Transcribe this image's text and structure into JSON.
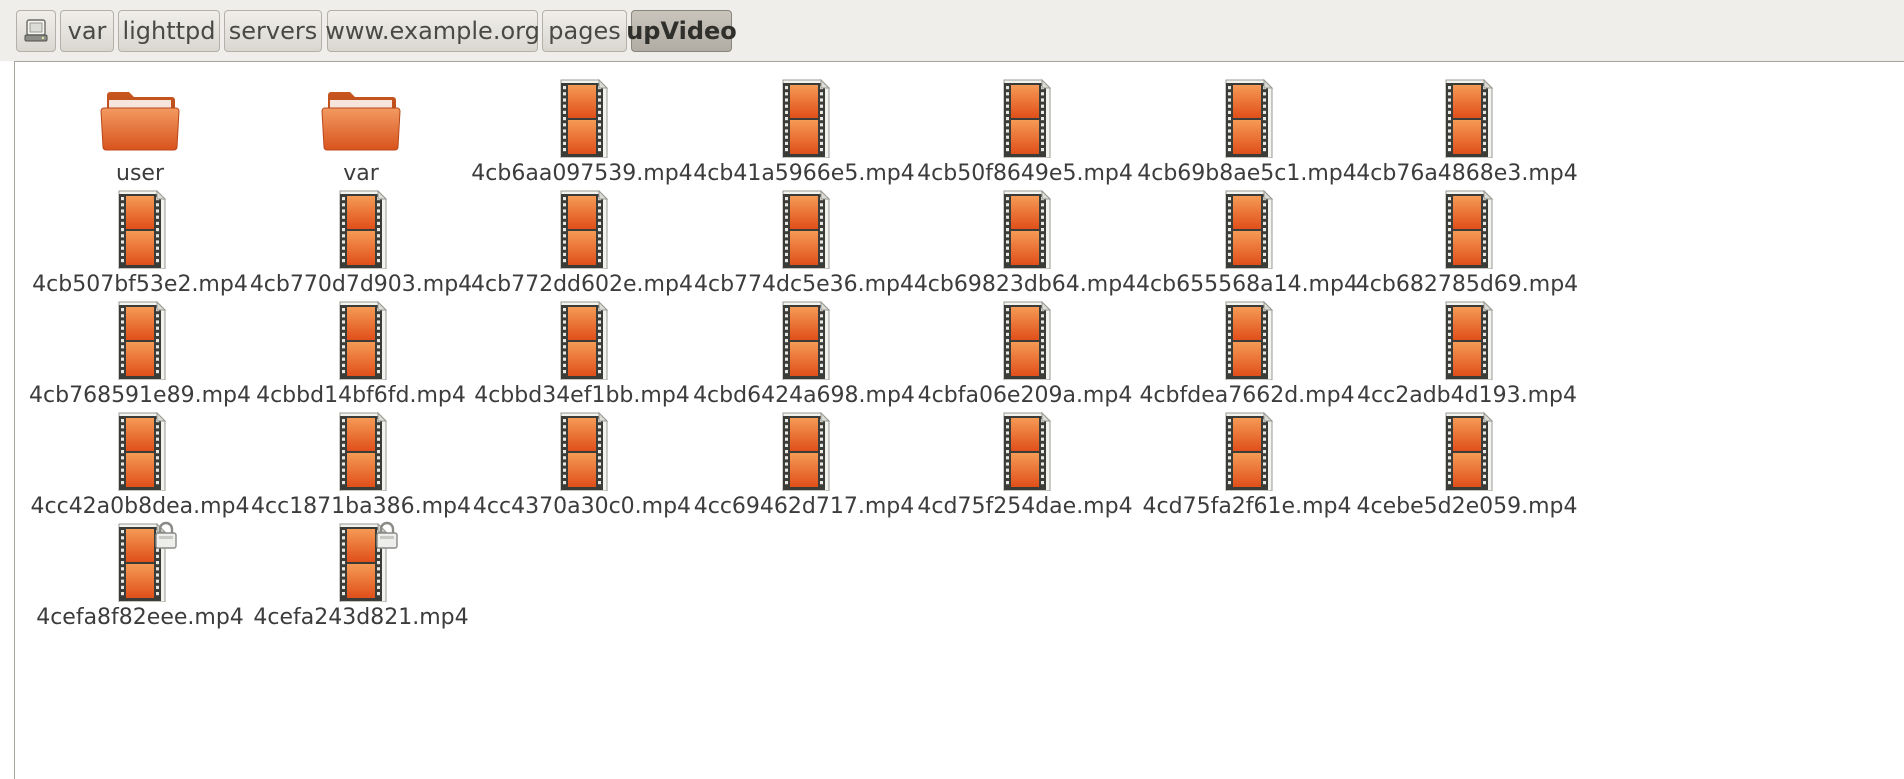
{
  "pathbar": {
    "home_icon": "drive-icon",
    "crumbs": [
      "var",
      "lighttpd",
      "servers",
      "www.example.org",
      "pages",
      "upVideo"
    ],
    "active_crumb": "upVideo"
  },
  "colors": {
    "folder_orange": "#e2622a",
    "video_orange": "#e8732c",
    "film_dark": "#3b3b38",
    "active_crumb_bg": "#bbb7ae"
  },
  "files": [
    {
      "name": "user",
      "type": "folder",
      "locked": false
    },
    {
      "name": "var",
      "type": "folder",
      "locked": false
    },
    {
      "name": "4cb6aa097539.mp4",
      "type": "video",
      "locked": false
    },
    {
      "name": "4cb41a5966e5.mp4",
      "type": "video",
      "locked": false
    },
    {
      "name": "4cb50f8649e5.mp4",
      "type": "video",
      "locked": false
    },
    {
      "name": "4cb69b8ae5c1.mp4",
      "type": "video",
      "locked": false
    },
    {
      "name": "4cb76a4868e3.mp4",
      "type": "video",
      "locked": false
    },
    {
      "name": "4cb507bf53e2.mp4",
      "type": "video",
      "locked": false
    },
    {
      "name": "4cb770d7d903.mp4",
      "type": "video",
      "locked": false
    },
    {
      "name": "4cb772dd602e.mp4",
      "type": "video",
      "locked": false
    },
    {
      "name": "4cb774dc5e36.mp4",
      "type": "video",
      "locked": false
    },
    {
      "name": "4cb69823db64.mp4",
      "type": "video",
      "locked": false
    },
    {
      "name": "4cb655568a14.mp4",
      "type": "video",
      "locked": false
    },
    {
      "name": "4cb682785d69.mp4",
      "type": "video",
      "locked": false
    },
    {
      "name": "4cb768591e89.mp4",
      "type": "video",
      "locked": false
    },
    {
      "name": "4cbbd14bf6fd.mp4",
      "type": "video",
      "locked": false
    },
    {
      "name": "4cbbd34ef1bb.mp4",
      "type": "video",
      "locked": false
    },
    {
      "name": "4cbd6424a698.mp4",
      "type": "video",
      "locked": false
    },
    {
      "name": "4cbfa06e209a.mp4",
      "type": "video",
      "locked": false
    },
    {
      "name": "4cbfdea7662d.mp4",
      "type": "video",
      "locked": false
    },
    {
      "name": "4cc2adb4d193.mp4",
      "type": "video",
      "locked": false
    },
    {
      "name": "4cc42a0b8dea.mp4",
      "type": "video",
      "locked": false
    },
    {
      "name": "4cc1871ba386.mp4",
      "type": "video",
      "locked": false
    },
    {
      "name": "4cc4370a30c0.mp4",
      "type": "video",
      "locked": false
    },
    {
      "name": "4cc69462d717.mp4",
      "type": "video",
      "locked": false
    },
    {
      "name": "4cd75f254dae.mp4",
      "type": "video",
      "locked": false
    },
    {
      "name": "4cd75fa2f61e.mp4",
      "type": "video",
      "locked": false
    },
    {
      "name": "4cebe5d2e059.mp4",
      "type": "video",
      "locked": false
    },
    {
      "name": "4cefa8f82eee.mp4",
      "type": "video",
      "locked": true
    },
    {
      "name": "4cefa243d821.mp4",
      "type": "video",
      "locked": true
    }
  ]
}
